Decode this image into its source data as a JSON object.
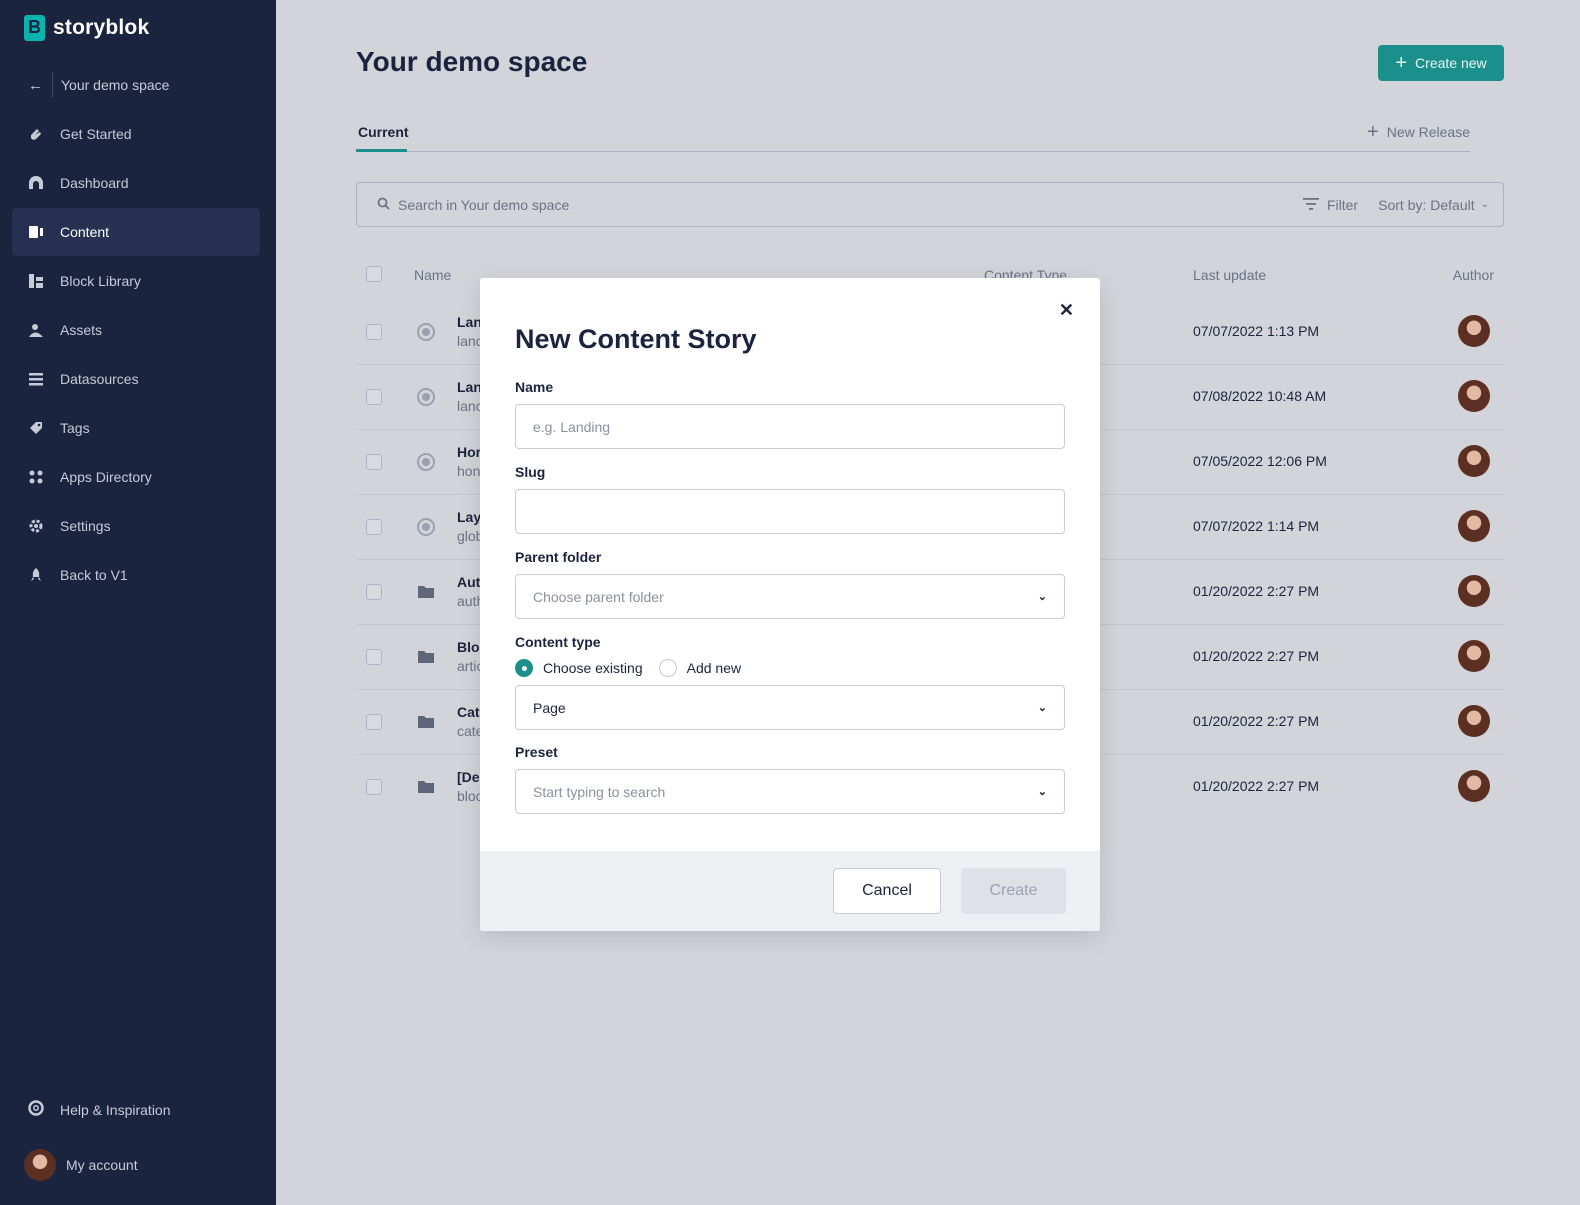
{
  "brand": {
    "name": "storyblok",
    "mark": "B",
    "accent": "#1b8f8c"
  },
  "sidebar": {
    "back_label": "Your demo space",
    "items": [
      {
        "label": "Get Started",
        "icon": "hand-wave-icon"
      },
      {
        "label": "Dashboard",
        "icon": "dashboard-icon"
      },
      {
        "label": "Content",
        "icon": "content-icon",
        "active": true
      },
      {
        "label": "Block Library",
        "icon": "block-library-icon"
      },
      {
        "label": "Assets",
        "icon": "assets-icon"
      },
      {
        "label": "Datasources",
        "icon": "datasources-icon"
      },
      {
        "label": "Tags",
        "icon": "tag-icon"
      },
      {
        "label": "Apps Directory",
        "icon": "apps-icon"
      },
      {
        "label": "Settings",
        "icon": "gear-icon"
      },
      {
        "label": "Back to V1",
        "icon": "rocket-icon"
      }
    ],
    "help_label": "Help & Inspiration",
    "account_label": "My account"
  },
  "main": {
    "title": "Your demo space",
    "create_new_label": "Create new",
    "tabs": [
      {
        "label": "Current",
        "active": true
      }
    ],
    "new_release_label": "New Release",
    "search_placeholder": "Search in Your demo space",
    "filter_label": "Filter",
    "sort_label": "Sort by: Default",
    "columns": {
      "name": "Name",
      "content_type": "Content Type",
      "last_update": "Last update",
      "author": "Author"
    },
    "rows": [
      {
        "name": "Lan",
        "slug": "lanc",
        "type": "story",
        "date": "07/07/2022 1:13 PM"
      },
      {
        "name": "Lan",
        "slug": "lanc",
        "type": "story",
        "date": "07/08/2022 10:48 AM"
      },
      {
        "name": "Hor",
        "slug": "hon",
        "type": "story",
        "date": "07/05/2022 12:06 PM"
      },
      {
        "name": "Lay",
        "slug": "glob",
        "type": "story",
        "date": "07/07/2022 1:14 PM"
      },
      {
        "name": "Aut",
        "slug": "auth",
        "type": "folder",
        "date": "01/20/2022 2:27 PM"
      },
      {
        "name": "Blo",
        "slug": "artic",
        "type": "folder",
        "date": "01/20/2022 2:27 PM"
      },
      {
        "name": "Cat",
        "slug": "cate",
        "type": "folder",
        "date": "01/20/2022 2:27 PM"
      },
      {
        "name": "[Der",
        "slug": "bloc",
        "type": "folder",
        "date": "01/20/2022 2:27 PM"
      }
    ]
  },
  "modal": {
    "title": "New Content Story",
    "close_icon": "close-icon",
    "name_label": "Name",
    "name_placeholder": "e.g. Landing",
    "name_value": "",
    "slug_label": "Slug",
    "slug_value": "",
    "parent_label": "Parent folder",
    "parent_placeholder": "Choose parent folder",
    "ctype_label": "Content type",
    "ctype_options": {
      "existing": "Choose existing",
      "new": "Add new",
      "selected": "existing"
    },
    "ctype_value": "Page",
    "preset_label": "Preset",
    "preset_placeholder": "Start typing to search",
    "cancel_label": "Cancel",
    "create_label": "Create"
  }
}
